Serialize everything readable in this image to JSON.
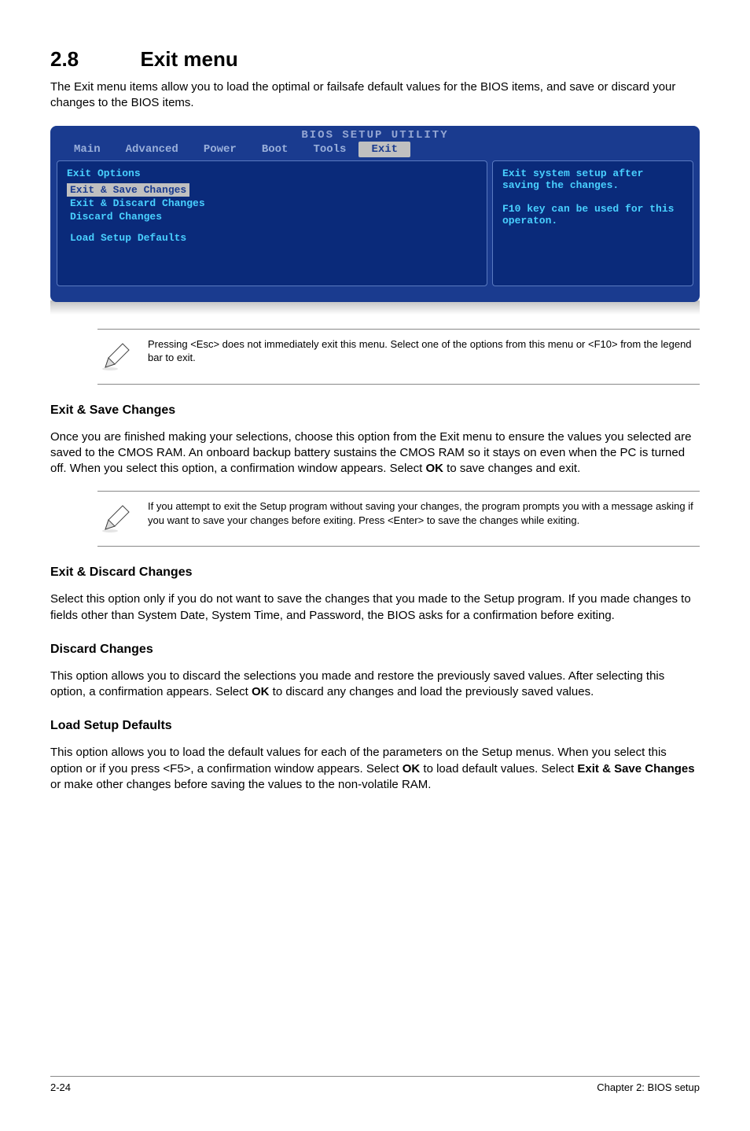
{
  "section": {
    "number": "2.8",
    "title": "Exit menu"
  },
  "intro": "The Exit menu items allow you to load the optimal or failsafe default values for the BIOS items, and save or discard your changes to the BIOS items.",
  "bios": {
    "title": "BIOS SETUP UTILITY",
    "tabs": [
      "Main",
      "Advanced",
      "Power",
      "Boot",
      "Tools",
      "Exit"
    ],
    "left_heading": "Exit Options",
    "items": [
      {
        "label": "Exit & Save Changes",
        "selected": true
      },
      {
        "label": "Exit & Discard Changes",
        "selected": false
      },
      {
        "label": "Discard Changes",
        "selected": false
      }
    ],
    "extra_item": "Load Setup Defaults",
    "help_text": "Exit system setup after saving the changes.\n\nF10 key can be used for this operaton."
  },
  "note1": "Pressing <Esc> does not immediately exit this menu. Select one of the options from this menu or <F10> from the legend bar to exit.",
  "sec1": {
    "heading": "Exit & Save Changes",
    "body_parts": [
      "Once you are finished making your selections, choose this option from the Exit menu to ensure the values you selected are saved to the CMOS RAM. An onboard backup battery sustains the CMOS RAM so it stays on even when the PC is turned off. When you select this option, a confirmation window appears. Select ",
      "OK",
      " to save changes and exit."
    ]
  },
  "note2": " If you attempt to exit the Setup program without saving your changes, the program prompts you with a message asking if you want to save your changes before exiting. Press <Enter> to save the changes while exiting.",
  "sec2": {
    "heading": "Exit & Discard Changes",
    "body": "Select this option only if you do not want to save the changes that you  made to the Setup program. If you made changes to fields other than System Date, System Time, and Password, the BIOS asks for a confirmation before exiting."
  },
  "sec3": {
    "heading": "Discard Changes",
    "body_parts": [
      "This option allows you to discard the selections you made and restore the previously saved values. After selecting this option, a confirmation appears. Select ",
      "OK",
      " to discard any changes and load the previously saved values."
    ]
  },
  "sec4": {
    "heading": "Load Setup Defaults",
    "body_parts": [
      "This option allows you to load the default values for each of the parameters on the Setup menus. When you select this option or if you press <F5>, a confirmation window appears. Select ",
      "OK",
      " to load default values. Select ",
      "Exit & Save Changes",
      " or make other changes before saving the values to the non-volatile RAM."
    ]
  },
  "footer": {
    "left": "2-24",
    "right": "Chapter 2: BIOS setup"
  }
}
